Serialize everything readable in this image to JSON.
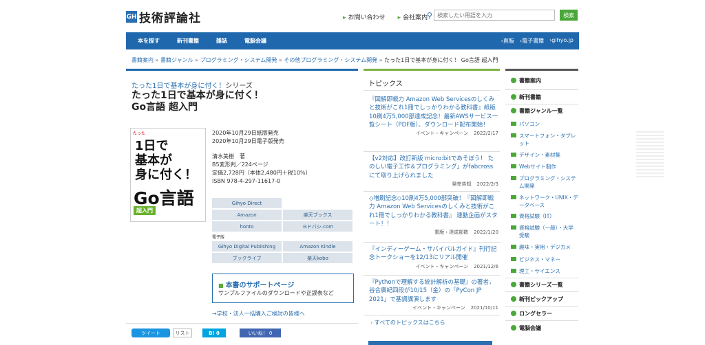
{
  "header": {
    "logo_mark": "GH",
    "logo_text": "技術評論社",
    "links": [
      "お問い合わせ",
      "会社案内"
    ],
    "search_placeholder": "検索したい用語を入力",
    "search_button": "検索"
  },
  "nav": {
    "left": [
      "本を探す",
      "新刊書籍",
      "雑誌",
      "電脳会議"
    ],
    "right": [
      "›直販",
      "›電子書籍",
      "›gihyo.jp"
    ]
  },
  "breadcrumb": [
    "書籍案内",
    "書籍ジャンル",
    "プログラミング・システム開発",
    "その他プログラミング・システム開発"
  ],
  "breadcrumb_sep": "»",
  "breadcrumb_current": "たった1日で基本が身に付く！ Go言語 超入門",
  "book": {
    "series_link": "たった1日で基本が身に付く！",
    "series_suffix": "シリーズ",
    "title_line1": "たった1日で基本が身に付く！",
    "title_line2": "Go言語 超入門",
    "cover_top": "たった",
    "cover_big": "1日で\n基本が\n身に付く！",
    "cover_go": "Go言語",
    "cover_chip": "超入門",
    "info": [
      "2020年10月29日紙版発売",
      "2020年10月29日電子版発売",
      "",
      "清水美樹　著",
      "B5変形判／224ページ",
      "定価2,728円（本体2,480円＋税10%）",
      "ISBN 978-4-297-11617-0"
    ],
    "buy_rows": [
      [
        "Gihyo Direct",
        ""
      ],
      [
        "Amazon",
        "楽天ブックス"
      ],
      [
        "honto",
        "ヨドバシ.com"
      ]
    ],
    "digital_label": "電子版",
    "digital_rows": [
      [
        "Gihyo Digital Publishing",
        "Amazon Kindle"
      ],
      [
        "ブックライブ",
        "楽天kobo"
      ]
    ],
    "support_title": "本書のサポートページ",
    "support_sub": "サンプルファイルのダウンロードや正誤表など",
    "bulk": "→学校・法人一括購入ご検討の皆様へ"
  },
  "social": {
    "tweet": "ツイート",
    "list": "リスト",
    "hatena": "B! 0",
    "fb": "いいね！ 0"
  },
  "topics": {
    "header": "トピックス",
    "items": [
      {
        "title": "『図解即戦力 Amazon Web Servicesのしくみと技術がこれ1冊でしっかりわかる教科書』紙版10刷4万5,000部達成記念！最新AWSサービス一覧シート（PDF版）、ダウンロード配布開始！",
        "cat": "イベント・キャンペーン",
        "date": "2022/2/17"
      },
      {
        "title": "【v2対応】改訂新版 micro:bitであそぼう！ たのしい電子工作＆プログラミング」がfabcrossにて取り上げられました",
        "cat": "発売告知",
        "date": "2022/2/3"
      },
      {
        "title": "◇増刷記念◇10刷4万5,000部突破！『図解即戦力 Amazon Web Servicesのしくみと技術がこれ1冊でしっかりわかる教科書』 連動企画がスタート！！",
        "cat": "重版・達成部数",
        "date": "2022/1/20"
      },
      {
        "title": "『インディーゲーム・サバイバルガイド』刊行記念トークショーを12/13にリアル開催",
        "cat": "イベント・キャンペーン",
        "date": "2021/12/6"
      },
      {
        "title": "『Pythonで理解する統計解析の基礎』の著者，谷合廣紀四段が10/15（金）の「PyCon JP 2021」で基調講演します",
        "cat": "イベント・キャンペーン",
        "date": "2021/10/11"
      }
    ],
    "all": "すべてのトピックスはこちら"
  },
  "sidebar": [
    {
      "label": "書籍案内",
      "kind": "h"
    },
    {
      "label": "新刊書籍",
      "kind": "h"
    },
    {
      "label": "書籍ジャンル一覧",
      "kind": "h"
    },
    {
      "label": "パソコン",
      "kind": "l"
    },
    {
      "label": "スマートフォン・タブレット",
      "kind": "l"
    },
    {
      "label": "デザイン・素材集",
      "kind": "l"
    },
    {
      "label": "Webサイト制作",
      "kind": "l"
    },
    {
      "label": "プログラミング・システム開発",
      "kind": "l"
    },
    {
      "label": "ネットワーク・UNIX・データベース",
      "kind": "l"
    },
    {
      "label": "資格試験（IT）",
      "kind": "l"
    },
    {
      "label": "資格試験（一般）・大学受験",
      "kind": "l"
    },
    {
      "label": "趣味・実用・デジカメ",
      "kind": "l"
    },
    {
      "label": "ビジネス・マネー",
      "kind": "l"
    },
    {
      "label": "理工・サイエンス",
      "kind": "l"
    },
    {
      "label": "書籍シリーズ一覧",
      "kind": "h"
    },
    {
      "label": "新刊ピックアップ",
      "kind": "h"
    },
    {
      "label": "ロングセラー",
      "kind": "h"
    },
    {
      "label": "電脳会議",
      "kind": "h"
    }
  ]
}
